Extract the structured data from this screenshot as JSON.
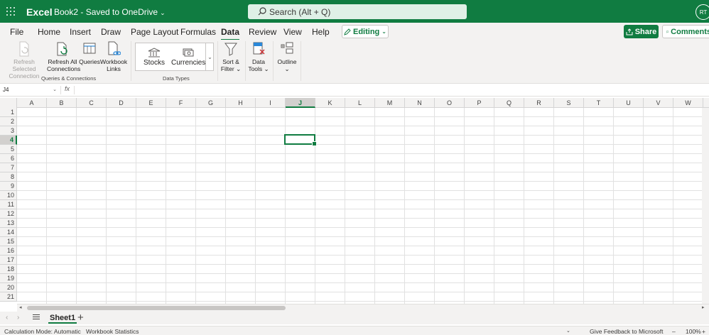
{
  "titlebar": {
    "app_name": "Excel",
    "doc_title": "Book2 - Saved to OneDrive",
    "search_placeholder": "Search (Alt + Q)",
    "avatar_initials": "RT",
    "accent_color": "#107c41"
  },
  "menu": {
    "tabs": [
      "File",
      "Home",
      "Insert",
      "Draw",
      "Page Layout",
      "Formulas",
      "Data",
      "Review",
      "View",
      "Help"
    ],
    "active_tab": "Data",
    "editing_label": "Editing",
    "share_label": "Share",
    "comments_label": "Comments"
  },
  "ribbon": {
    "queries_group": {
      "label": "Queries & Connections",
      "refresh_selected_l1": "Refresh Selected",
      "refresh_selected_l2": "Connection",
      "refresh_all_l1": "Refresh All",
      "refresh_all_l2": "Connections",
      "queries": "Queries",
      "workbook_links_l1": "Workbook",
      "workbook_links_l2": "Links"
    },
    "data_types_group": {
      "label": "Data Types",
      "stocks": "Stocks",
      "currencies": "Currencies"
    },
    "sort_filter_l1": "Sort &",
    "sort_filter_l2": "Filter",
    "data_tools_l1": "Data",
    "data_tools_l2": "Tools",
    "outline": "Outline"
  },
  "formula_bar": {
    "name_box": "J4",
    "fx": "fx"
  },
  "grid": {
    "columns": [
      "A",
      "B",
      "C",
      "D",
      "E",
      "F",
      "G",
      "H",
      "I",
      "J",
      "K",
      "L",
      "M",
      "N",
      "O",
      "P",
      "Q",
      "R",
      "S",
      "T",
      "U",
      "V",
      "W"
    ],
    "rows": [
      "1",
      "2",
      "3",
      "4",
      "5",
      "6",
      "7",
      "8",
      "9",
      "10",
      "11",
      "12",
      "13",
      "14",
      "15",
      "16",
      "17",
      "18",
      "19",
      "20",
      "21"
    ],
    "selected_cell": "J4"
  },
  "sheets": {
    "tabs": [
      "Sheet1"
    ]
  },
  "status": {
    "calc_mode": "Calculation Mode: Automatic",
    "workbook_stats": "Workbook Statistics",
    "feedback": "Give Feedback to Microsoft",
    "zoom": "100%"
  }
}
